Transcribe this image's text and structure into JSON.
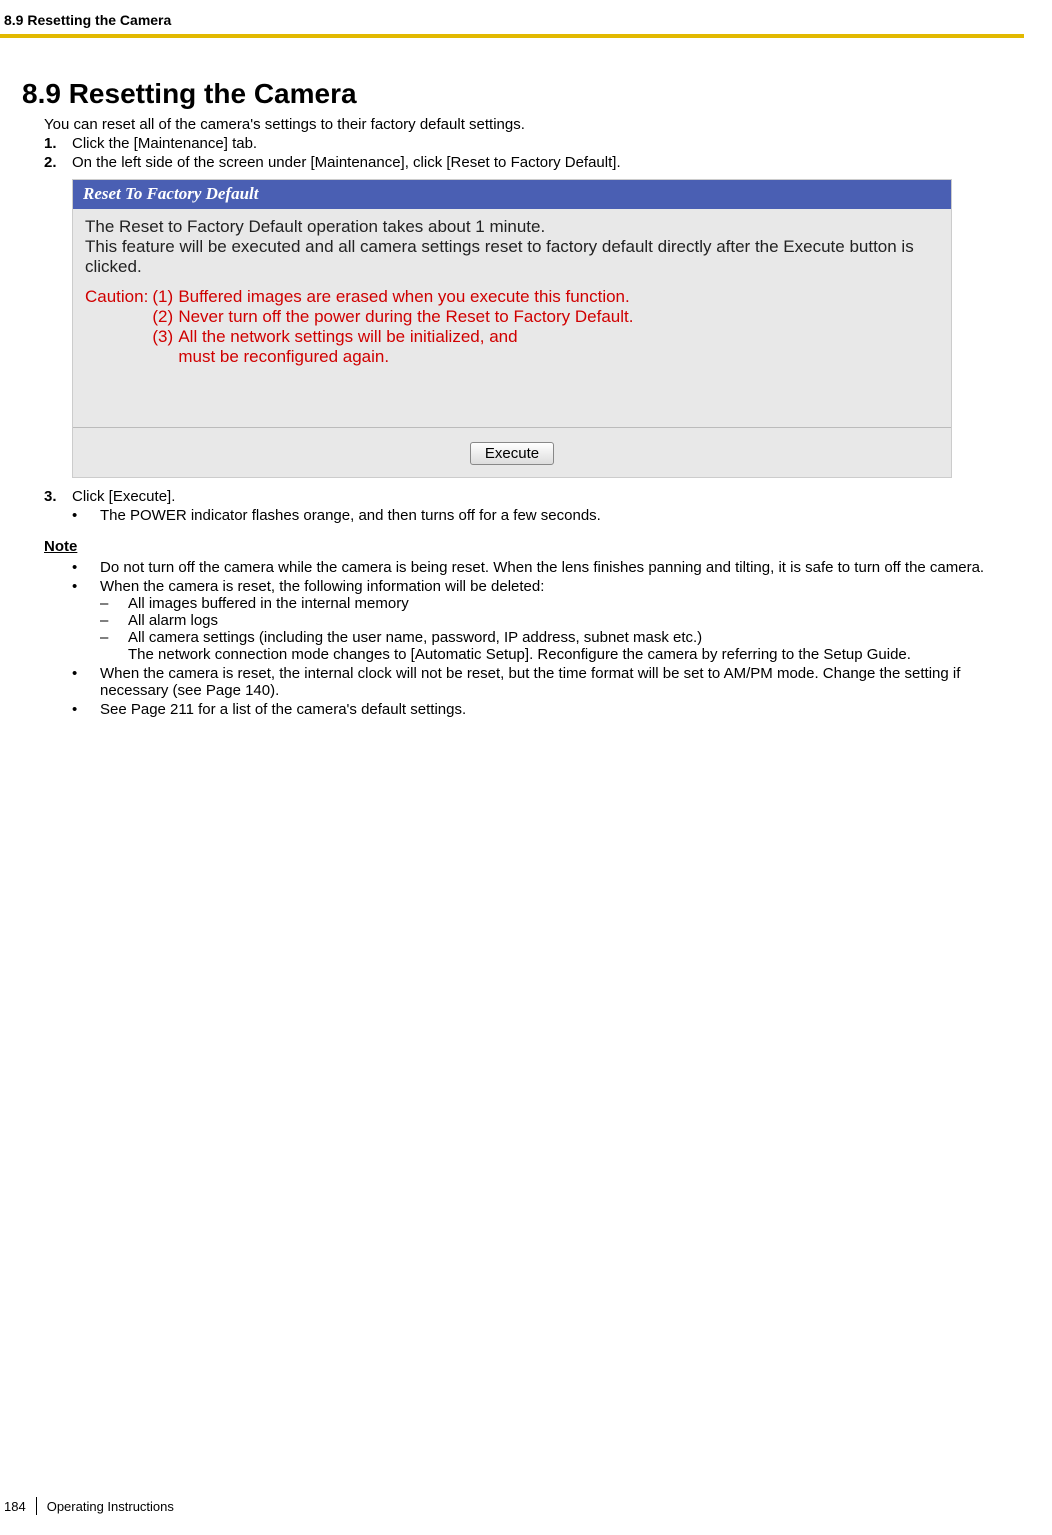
{
  "header": {
    "breadcrumb": "8.9 Resetting the Camera"
  },
  "section": {
    "heading": "8.9  Resetting the Camera",
    "intro": "You can reset all of the camera's settings to their factory default settings.",
    "steps": {
      "s1_num": "1.",
      "s1_text": "Click the [Maintenance] tab.",
      "s2_num": "2.",
      "s2_text": "On the left side of the screen under [Maintenance], click [Reset to Factory Default].",
      "s3_num": "3.",
      "s3_text": "Click [Execute].",
      "s3_sub": "The POWER indicator flashes orange, and then turns off for a few seconds."
    }
  },
  "screenshot": {
    "title": "Reset To Factory Default",
    "line1": "The Reset to Factory Default operation takes about 1 minute.",
    "line2": "This feature will be executed and all camera settings reset to factory default directly after the Execute button is clicked.",
    "caution_label": "Caution:",
    "c1_num": "(1)",
    "c1_text": "Buffered images are erased when you execute this function.",
    "c2_num": "(2)",
    "c2_text": "Never turn off the power during the Reset to Factory Default.",
    "c3_num": "(3)",
    "c3_text": "All the network settings will be initialized, and",
    "c3_text2": "must be reconfigured again.",
    "button": "Execute"
  },
  "note": {
    "heading": "Note",
    "n1": "Do not turn off the camera while the camera is being reset. When the lens finishes panning and tilting, it is safe to turn off the camera.",
    "n2": "When the camera is reset, the following information will be deleted:",
    "d1": "All images buffered in the internal memory",
    "d2": "All alarm logs",
    "d3": "All camera settings (including the user name, password, IP address, subnet mask etc.)",
    "d3b": "The network connection mode changes to [Automatic Setup]. Reconfigure the camera by referring to the Setup Guide.",
    "n3": "When the camera is reset, the internal clock will not be reset, but the time format will be set to AM/PM mode. Change the setting if necessary (see Page 140).",
    "n4": "See Page 211 for a list of the camera's default settings."
  },
  "footer": {
    "page": "184",
    "doc": "Operating Instructions"
  },
  "glyphs": {
    "bullet": "•",
    "dash": "–"
  }
}
